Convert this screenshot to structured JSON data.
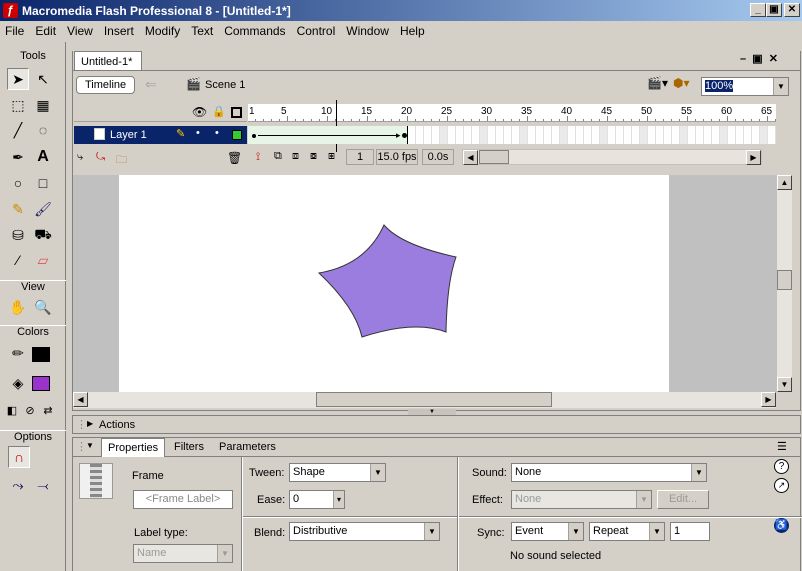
{
  "window": {
    "title": "Macromedia Flash Professional 8 - [Untitled-1*]",
    "minimize": "_",
    "restore": "▣",
    "close": "✕"
  },
  "menu": [
    "File",
    "Edit",
    "View",
    "Insert",
    "Modify",
    "Text",
    "Commands",
    "Control",
    "Window",
    "Help"
  ],
  "tools": {
    "label": "Tools",
    "view_label": "View",
    "colors_label": "Colors",
    "options_label": "Options"
  },
  "document": {
    "tab": "Untitled-1*",
    "timeline_button": "Timeline",
    "scene": "Scene 1",
    "zoom": "100%"
  },
  "timeline": {
    "layer_name": "Layer 1",
    "ruler": [
      "1",
      "5",
      "10",
      "15",
      "20",
      "25",
      "30",
      "35",
      "40",
      "45",
      "50",
      "55",
      "60",
      "65"
    ],
    "current_frame": "1",
    "fps": "15.0 fps",
    "elapsed": "0.0s"
  },
  "stage": {
    "shape_color": "#9b7ddf"
  },
  "panels": {
    "actions": "Actions",
    "tabs": [
      "Properties",
      "Filters",
      "Parameters"
    ]
  },
  "properties": {
    "frame_label": "Frame",
    "frame_placeholder": "<Frame Label>",
    "label_type_label": "Label type:",
    "label_type_value": "Name",
    "tween_label": "Tween:",
    "tween_value": "Shape",
    "ease_label": "Ease:",
    "ease_value": "0",
    "blend_label": "Blend:",
    "blend_value": "Distributive",
    "sound_label": "Sound:",
    "sound_value": "None",
    "effect_label": "Effect:",
    "effect_value": "None",
    "edit_button": "Edit...",
    "sync_label": "Sync:",
    "sync_value": "Event",
    "repeat_value": "Repeat",
    "repeat_count": "1",
    "status": "No sound selected"
  },
  "colors": {
    "stroke": "#000000",
    "fill": "#9933cc"
  }
}
